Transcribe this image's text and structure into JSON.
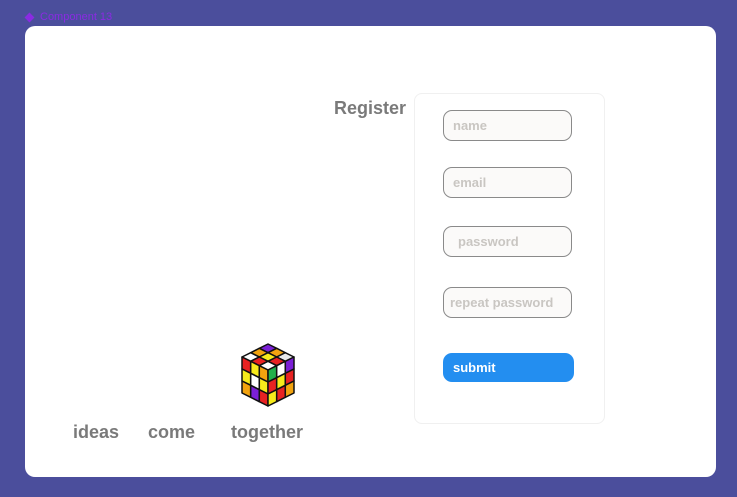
{
  "component_label": "Component 13",
  "form": {
    "title": "Register",
    "name_placeholder": "name",
    "email_placeholder": "email",
    "password_placeholder": "password",
    "repeat_password_placeholder": "repeat password",
    "submit_label": "submit"
  },
  "tagline": {
    "word1": "ideas",
    "word2": "come",
    "word3": "together"
  },
  "colors": {
    "background": "#4b4e9c",
    "accent": "#238ef0",
    "component_label": "#8a2be2"
  },
  "icons": [
    "rubiks-cube-icon"
  ]
}
